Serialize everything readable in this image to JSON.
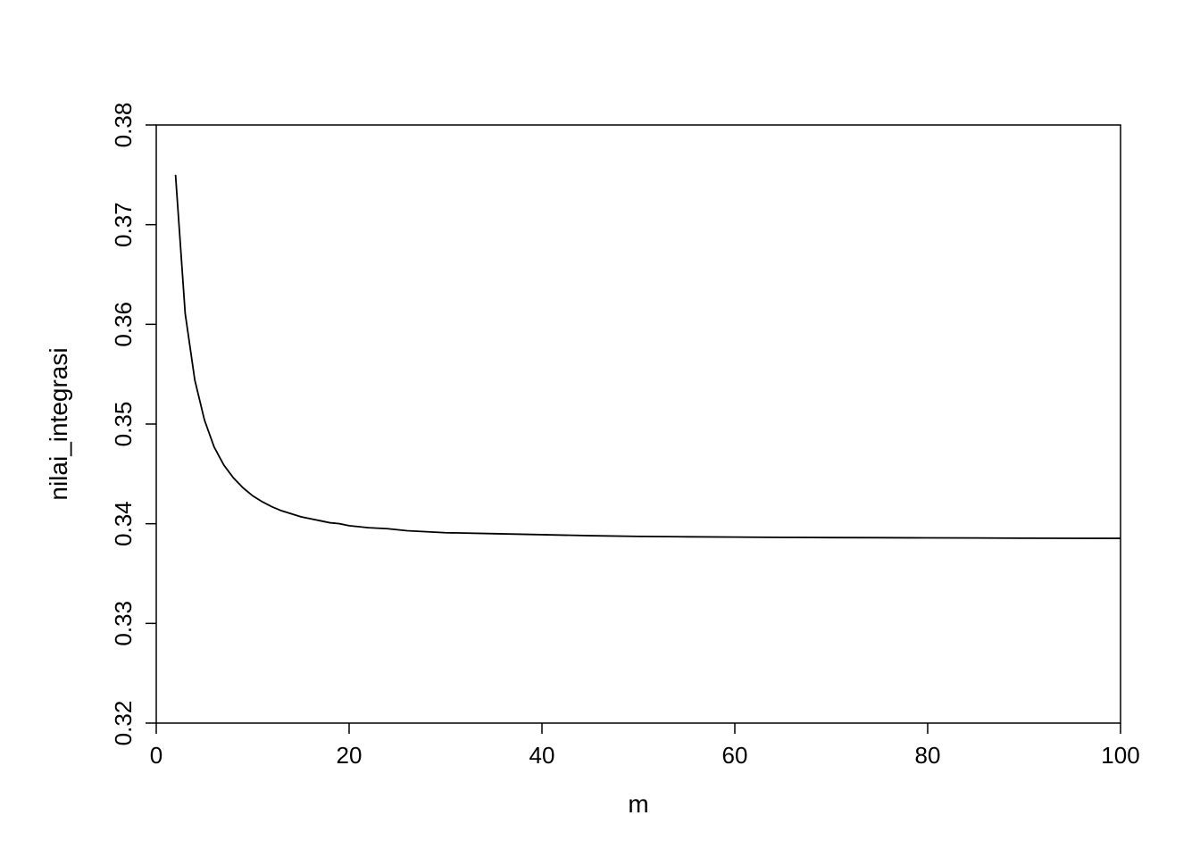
{
  "chart_data": {
    "type": "line",
    "xlabel": "m",
    "ylabel": "nilai_integrasi",
    "xlim": [
      0,
      100
    ],
    "ylim": [
      0.32,
      0.38
    ],
    "x_ticks": [
      0,
      20,
      40,
      60,
      80,
      100
    ],
    "y_ticks": [
      0.32,
      0.33,
      0.34,
      0.35,
      0.36,
      0.37,
      0.38
    ],
    "x": [
      2,
      3,
      4,
      5,
      6,
      7,
      8,
      9,
      10,
      11,
      12,
      13,
      14,
      15,
      16,
      17,
      18,
      19,
      20,
      22,
      24,
      26,
      28,
      30,
      35,
      40,
      45,
      50,
      55,
      60,
      65,
      70,
      75,
      80,
      85,
      90,
      95,
      100
    ],
    "y": [
      0.375,
      0.3611,
      0.3544,
      0.3504,
      0.3477,
      0.3459,
      0.3446,
      0.3436,
      0.3428,
      0.3422,
      0.3417,
      0.3413,
      0.341,
      0.3407,
      0.3405,
      0.3403,
      0.3401,
      0.34,
      0.3398,
      0.3396,
      0.3395,
      0.3393,
      0.3392,
      0.3391,
      0.339,
      0.3389,
      0.3388,
      0.33873,
      0.33869,
      0.33866,
      0.33863,
      0.33861,
      0.3386,
      0.33858,
      0.33857,
      0.33855,
      0.33854,
      0.33853
    ],
    "series_color": "#000000",
    "title": ""
  }
}
